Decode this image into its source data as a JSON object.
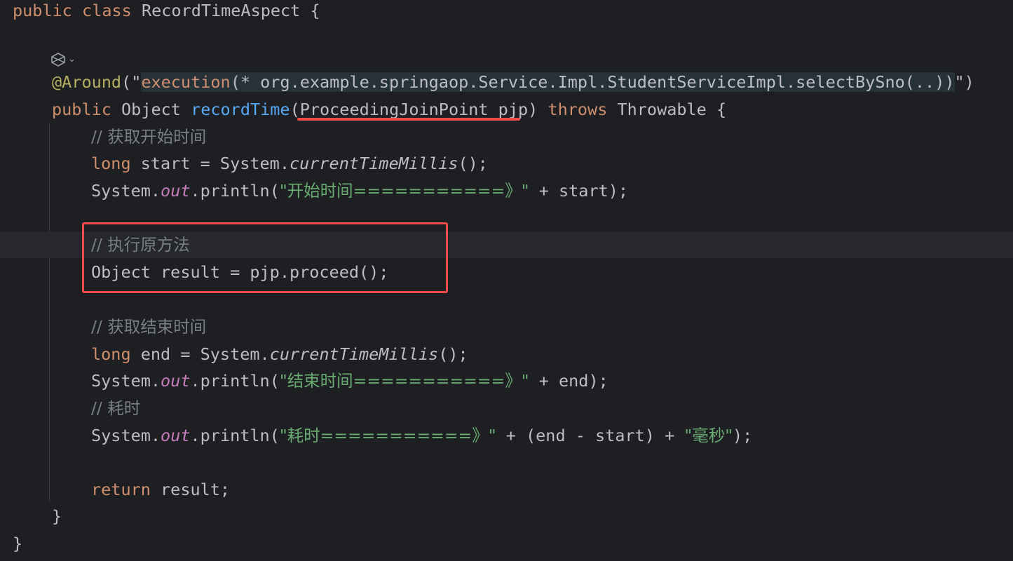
{
  "editor": {
    "language": "java",
    "class_decl": {
      "public": "public",
      "class": "class",
      "name": "RecordTimeAspect",
      "open": " {"
    },
    "gutter_icons": [
      "aspect-icon",
      "chevron-down-icon"
    ],
    "annotation": {
      "name": "@Around",
      "open": "(\"",
      "execution": "execution",
      "pointcut": "(* org.example.springaop.Service.Impl.StudentServiceImpl.selectBySno(..))",
      "close": "\")"
    },
    "method": {
      "public": "public",
      "return_type": " Object ",
      "name": "recordTime",
      "param_open": "(",
      "param": "ProceedingJoinPoint pjp",
      "param_close": ")",
      "throws": "throws",
      "exception": " Throwable {"
    },
    "body": {
      "comment_start": "// 获取开始时间",
      "long1": "long",
      "start_decl_a": " start = System.",
      "start_call": "currentTimeMillis",
      "start_decl_b": "();",
      "sys1": "System.",
      "out1": "out",
      "println1": ".println(",
      "str1": "\"开始时间===========》\"",
      "tail1": " + start);",
      "comment_proceed": "// 执行原方法",
      "proceed_line": "Object result = pjp.proceed();",
      "comment_end": "// 获取结束时间",
      "long2": "long",
      "end_decl_a": " end = System.",
      "end_call": "currentTimeMillis",
      "end_decl_b": "();",
      "sys2": "System.",
      "out2": "out",
      "println2": ".println(",
      "str2": "\"结束时间===========》\"",
      "tail2": " + end);",
      "comment_elapsed": "// 耗时",
      "sys3": "System.",
      "out3": "out",
      "println3": ".println(",
      "str3": "\"耗时===========》\"",
      "mid3": " + (end - start) + ",
      "str4": "\"毫秒\"",
      "tail3": ");",
      "return_kw": "return",
      "return_tail": " result;"
    },
    "method_close": "}",
    "class_close": "}",
    "highlight_color": "#ef4b4b"
  }
}
